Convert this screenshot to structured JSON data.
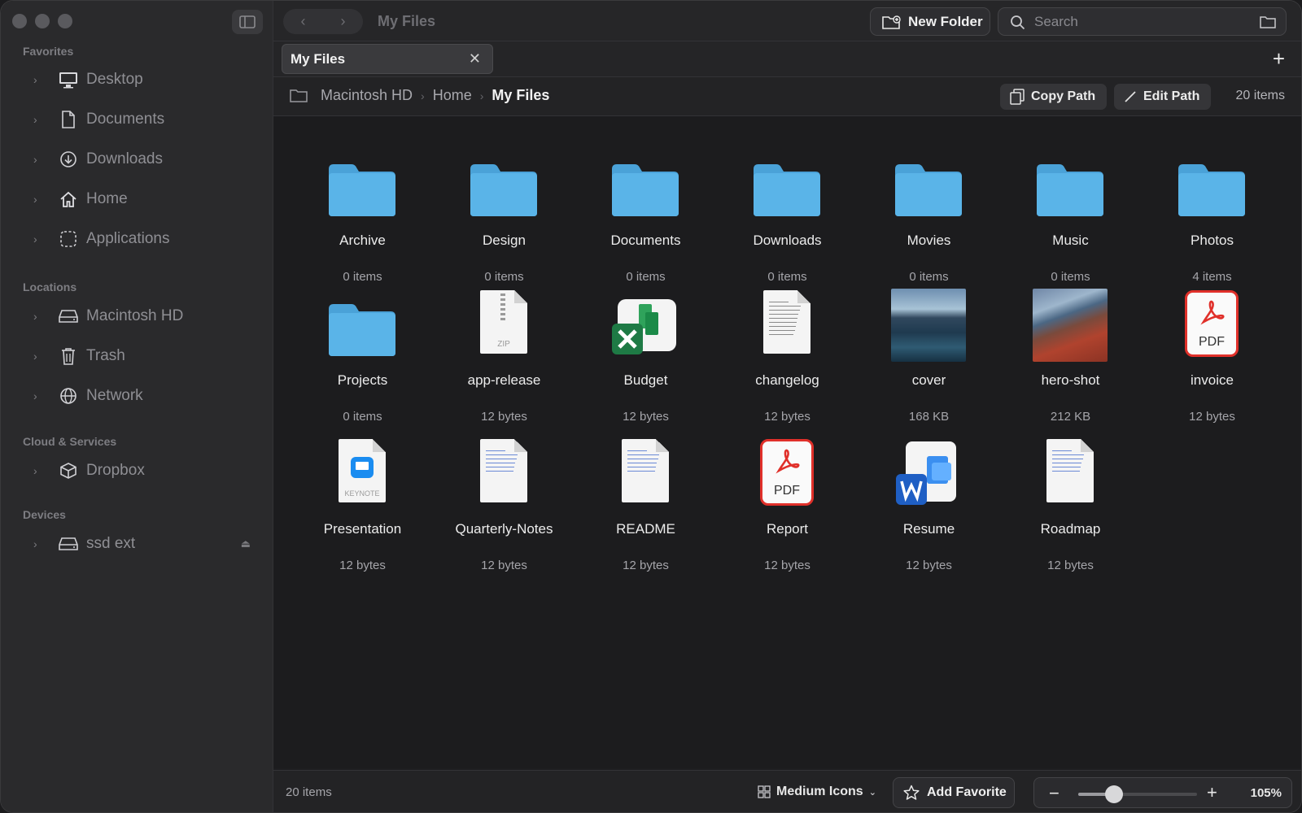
{
  "window": {
    "title": "My Files"
  },
  "toolbar": {
    "new_folder_label": "New Folder",
    "search_placeholder": "Search"
  },
  "tab": {
    "label": "My Files"
  },
  "breadcrumb": [
    "Macintosh HD",
    "Home",
    "My Files"
  ],
  "pathbar": {
    "copy_path_label": "Copy Path",
    "edit_path_label": "Edit Path",
    "item_count": "20 items"
  },
  "sidebar": {
    "favorites_title": "Favorites",
    "favorites": [
      {
        "label": "Desktop",
        "icon": "desktop-icon"
      },
      {
        "label": "Documents",
        "icon": "document-icon"
      },
      {
        "label": "Downloads",
        "icon": "download-icon"
      },
      {
        "label": "Home",
        "icon": "home-icon"
      },
      {
        "label": "Applications",
        "icon": "applications-icon"
      }
    ],
    "locations_title": "Locations",
    "locations": [
      {
        "label": "Macintosh HD",
        "icon": "drive-icon"
      },
      {
        "label": "Trash",
        "icon": "trash-icon"
      },
      {
        "label": "Network",
        "icon": "globe-icon"
      }
    ],
    "cloud_title": "Cloud & Services",
    "cloud": [
      {
        "label": "Dropbox",
        "icon": "box-icon"
      }
    ],
    "devices_title": "Devices",
    "devices": [
      {
        "label": "ssd ext",
        "icon": "drive-icon"
      }
    ]
  },
  "files": [
    {
      "name": "Archive",
      "meta": "0 items",
      "kind": "folder"
    },
    {
      "name": "Design",
      "meta": "0 items",
      "kind": "folder"
    },
    {
      "name": "Documents",
      "meta": "0 items",
      "kind": "folder"
    },
    {
      "name": "Downloads",
      "meta": "0 items",
      "kind": "folder"
    },
    {
      "name": "Movies",
      "meta": "0 items",
      "kind": "folder"
    },
    {
      "name": "Music",
      "meta": "0 items",
      "kind": "folder"
    },
    {
      "name": "Photos",
      "meta": "4 items",
      "kind": "folder"
    },
    {
      "name": "Projects",
      "meta": "0 items",
      "kind": "folder"
    },
    {
      "name": "app-release",
      "meta": "12 bytes",
      "kind": "zip",
      "type_label": "ZIP"
    },
    {
      "name": "Budget",
      "meta": "12 bytes",
      "kind": "excel"
    },
    {
      "name": "changelog",
      "meta": "12 bytes",
      "kind": "text"
    },
    {
      "name": "cover",
      "meta": "168 KB",
      "kind": "photo"
    },
    {
      "name": "hero-shot",
      "meta": "212 KB",
      "kind": "photo2"
    },
    {
      "name": "invoice",
      "meta": "12 bytes",
      "kind": "pdf",
      "type_label": "PDF"
    },
    {
      "name": "Presentation",
      "meta": "12 bytes",
      "kind": "keynote",
      "type_label": "KEYNOTE"
    },
    {
      "name": "Quarterly-Notes",
      "meta": "12 bytes",
      "kind": "markdown"
    },
    {
      "name": "README",
      "meta": "12 bytes",
      "kind": "markdown"
    },
    {
      "name": "Report",
      "meta": "12 bytes",
      "kind": "pdf",
      "type_label": "PDF"
    },
    {
      "name": "Resume",
      "meta": "12 bytes",
      "kind": "word"
    },
    {
      "name": "Roadmap",
      "meta": "12 bytes",
      "kind": "markdown"
    }
  ],
  "statusbar": {
    "item_count": "20 items",
    "view_mode": "Medium Icons",
    "add_favorite_label": "Add Favorite",
    "zoom_level": "105%",
    "zoom_fraction": 0.3
  },
  "colors": {
    "folder": "#5ab4e8",
    "folder_tab": "#4aa2d8",
    "pdf_red": "#e0302a",
    "excel_green": "#1e7a45",
    "word_blue": "#1f5fc4"
  }
}
